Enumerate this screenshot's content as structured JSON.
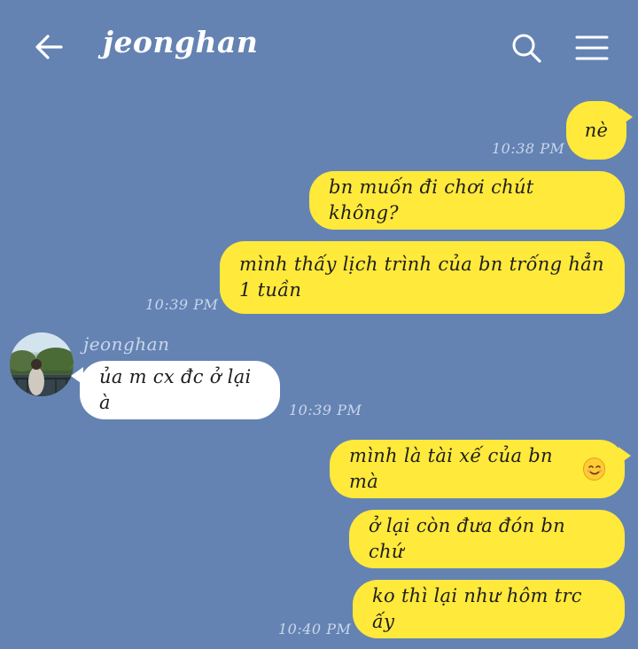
{
  "header": {
    "title": "jeonghan",
    "back_icon": "arrow-left-icon",
    "search_icon": "search-icon",
    "menu_icon": "hamburger-menu-icon"
  },
  "colors": {
    "background": "#6483b3",
    "outgoing_bubble": "#ffe93b",
    "incoming_bubble": "#ffffff",
    "timestamp": "#c9d6ea"
  },
  "messages": [
    {
      "direction": "out",
      "text": "nè"
    },
    {
      "direction": "out",
      "text": "bn muốn đi chơi chút không?"
    },
    {
      "direction": "out",
      "text_line1": "mình thấy lịch trình của bn trống hẳn",
      "text_line2": "1 tuần"
    },
    {
      "direction": "in",
      "sender": "jeonghan",
      "text": "ủa m cx đc ở lại à"
    },
    {
      "direction": "out",
      "text": "mình là tài xế của bn mà",
      "emoji": "smiling-face-icon"
    },
    {
      "direction": "out",
      "text": "ở lại còn đưa đón bn chứ"
    },
    {
      "direction": "out",
      "text": "ko thì lại như hôm trc ấy"
    }
  ],
  "timestamps": {
    "t1": "10:38 PM",
    "t2": "10:39 PM",
    "t3": "10:39 PM",
    "t4": "10:40 PM"
  }
}
